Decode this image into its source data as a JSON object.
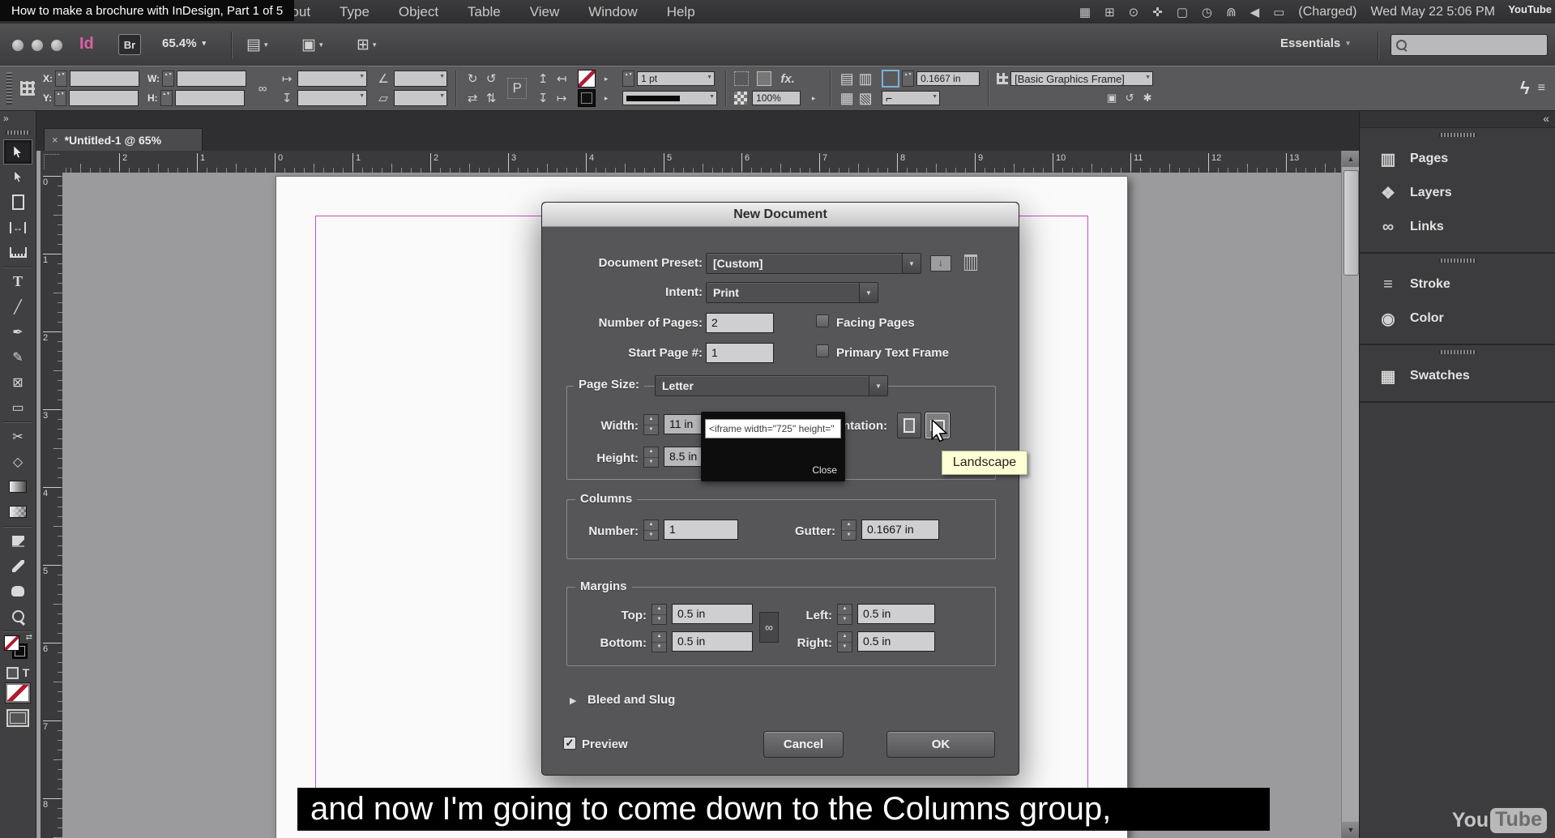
{
  "menubar": {
    "video_title": "How to make a brochure with InDesign, Part 1 of 5",
    "menus": [
      "Layout",
      "Type",
      "Object",
      "Table",
      "View",
      "Window",
      "Help"
    ],
    "battery_text": "(Charged)",
    "clock_text": "Wed May 22  5:06 PM",
    "watermark": "YouTube"
  },
  "appbar": {
    "logo": "Id",
    "bridge": "Br",
    "zoom": "65.4%",
    "workspace": "Essentials"
  },
  "control": {
    "x": "X:",
    "y": "Y:",
    "w": "W:",
    "h": "H:",
    "stroke_weight": "1 pt",
    "opacity": "100%",
    "fit": "0.1667 in",
    "object_style": "[Basic Graphics Frame]",
    "p": "P",
    "fx": "fx."
  },
  "tab": {
    "close": "×",
    "title": "*Untitled-1 @ 65%"
  },
  "hruler": {
    "labels": [
      "2",
      "1",
      "0",
      "1",
      "2",
      "3",
      "4",
      "5",
      "6",
      "7",
      "8",
      "9",
      "10",
      "11",
      "12",
      "13"
    ]
  },
  "vruler": {
    "labels": [
      "0",
      "1",
      "2",
      "3",
      "4",
      "5",
      "6",
      "7",
      "8"
    ]
  },
  "dock": {
    "collapse": "«",
    "items": [
      "Pages",
      "Layers",
      "Links",
      "Stroke",
      "Color",
      "Swatches"
    ]
  },
  "toolbar": {
    "expand": "»"
  },
  "dialog": {
    "title": "New Document",
    "preset_label": "Document Preset:",
    "preset_value": "[Custom]",
    "intent_label": "Intent:",
    "intent_value": "Print",
    "pages_label": "Number of Pages:",
    "pages_value": "2",
    "facing_pages": "Facing Pages",
    "start_label": "Start Page #:",
    "start_value": "1",
    "primary_text_frame": "Primary Text Frame",
    "page_size_label": "Page Size:",
    "page_size_value": "Letter",
    "width_label": "Width:",
    "width_value": "11 in",
    "height_label": "Height:",
    "height_value": "8.5 in",
    "orientation_label": "Orientation:",
    "columns_legend": "Columns",
    "number_label": "Number:",
    "number_value": "1",
    "gutter_label": "Gutter:",
    "gutter_value": "0.1667 in",
    "margins_legend": "Margins",
    "top_label": "Top:",
    "top_value": "0.5 in",
    "bottom_label": "Bottom:",
    "bottom_value": "0.5 in",
    "left_label": "Left:",
    "left_value": "0.5 in",
    "right_label": "Right:",
    "right_value": "0.5 in",
    "bleed_slug": "Bleed and Slug",
    "preview": "Preview",
    "cancel": "Cancel",
    "ok": "OK"
  },
  "popup": {
    "embed_code": "<iframe width=\"725\" height=\"",
    "close": "Close"
  },
  "tooltip": "Landscape",
  "caption": "and now I'm going to come down to the Columns group,",
  "watermark": {
    "you": "You",
    "tube": "Tube"
  },
  "icons": {
    "dd": "▼",
    "dd_small": "▾",
    "up": "▲",
    "down": "▼",
    "right_arrow": "▸",
    "bleed_arrow": "▶",
    "check": "✓",
    "film": "▦",
    "sync": "⊞",
    "alert": "⊙",
    "move": "✜",
    "display": "▢",
    "clock": "◷",
    "wifi": "⋒",
    "speaker": "◀",
    "battery": "▭",
    "view_options": "▤",
    "screen_mode": "▣",
    "arrange_docs": "⊞",
    "gap": "↔",
    "type": "T",
    "line": "╱",
    "pen": "✒",
    "pencil": "✎",
    "frame": "⊠",
    "rect": "▭",
    "scissors": "✂",
    "free_transform": "◇",
    "rotate_cw": "↻",
    "rotate_ccw": "↺",
    "fliph": "⇄",
    "flipv": "⇅",
    "angle": "∠",
    "shear": "▱",
    "chain": "∞",
    "hier_up": "↥",
    "hier_down": "↧",
    "hier_left": "↤",
    "hier_right": "↦",
    "wrap1": "▤",
    "wrap2": "▥",
    "wrap3": "▦",
    "wrap4": "▧",
    "corner": "⌐",
    "lightning": "ϟ",
    "panel_menu": "≡",
    "override1": "▣",
    "override2": "↺",
    "override3": "✱",
    "pages": "▥",
    "layers": "❖",
    "links": "∞",
    "stroke": "≡",
    "color": "◉",
    "swatches": "▦"
  },
  "colors": {
    "margin_guide": "#c44fc4",
    "logo_pink": "#df5fa5",
    "tooltip_bg": "#ffffd6",
    "caption_bg": "#000000",
    "caption_fg": "#ffffff"
  }
}
